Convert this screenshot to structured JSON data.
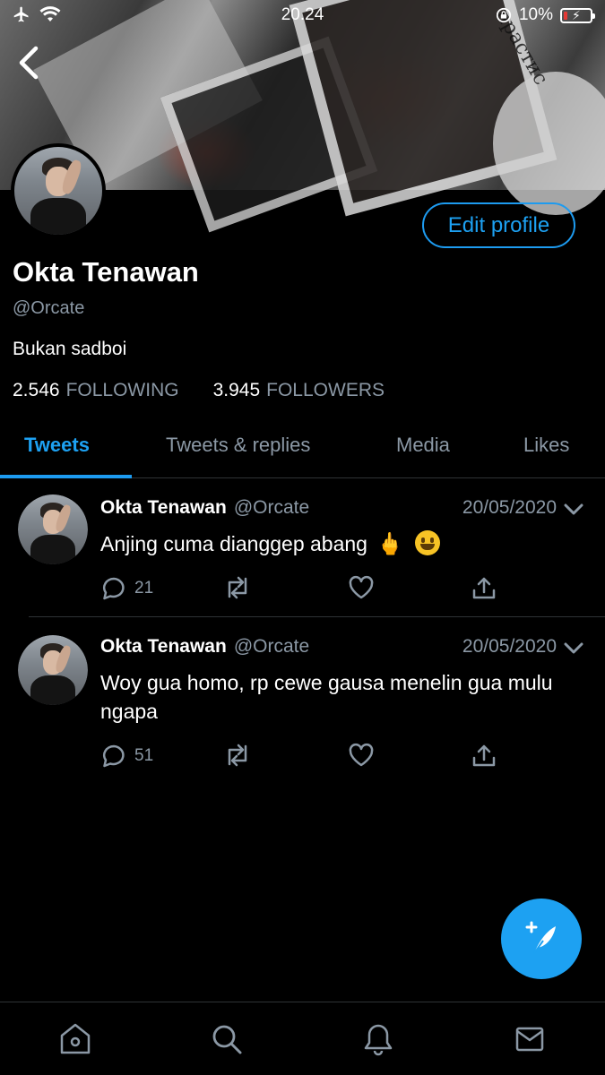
{
  "status_bar": {
    "time": "20.24",
    "battery_percent": "10%"
  },
  "profile": {
    "name": "Okta Tenawan",
    "handle": "@Orcate",
    "bio": "Bukan sadboi",
    "following_count": "2.546",
    "following_label": "FOLLOWING",
    "followers_count": "3.945",
    "followers_label": "FOLLOWERS",
    "edit_profile_label": "Edit profile"
  },
  "tabs": [
    {
      "label": "Tweets",
      "active": true
    },
    {
      "label": "Tweets & replies",
      "active": false
    },
    {
      "label": "Media",
      "active": false
    },
    {
      "label": "Likes",
      "active": false
    }
  ],
  "tweets": [
    {
      "author": "Okta Tenawan",
      "handle": "@Orcate",
      "date": "20/05/2020",
      "text": "Anjing cuma dianggep abang",
      "emoji_names": [
        "middle-finger-emoji",
        "smiley-emoji"
      ],
      "reply_count": "21"
    },
    {
      "author": "Okta Tenawan",
      "handle": "@Orcate",
      "date": "20/05/2020",
      "text": "Woy gua homo, rp cewe gausa menelin gua mulu ngapa",
      "reply_count": "51"
    }
  ],
  "banner_text": "прастис",
  "colors": {
    "accent": "#1da1f2",
    "background": "#000000",
    "muted": "#8b98a5",
    "divider": "#2f3336"
  },
  "icons": {
    "back": "chevron-left-icon",
    "airplane": "airplane-icon",
    "wifi": "wifi-icon",
    "rotation_lock": "rotation-lock-icon",
    "battery": "battery-icon",
    "reply": "comment-icon",
    "retweet": "retweet-icon",
    "like": "heart-icon",
    "share": "share-icon",
    "compose": "compose-tweet-icon",
    "home": "home-icon",
    "search": "search-icon",
    "notifications": "bell-icon",
    "messages": "mail-icon"
  }
}
